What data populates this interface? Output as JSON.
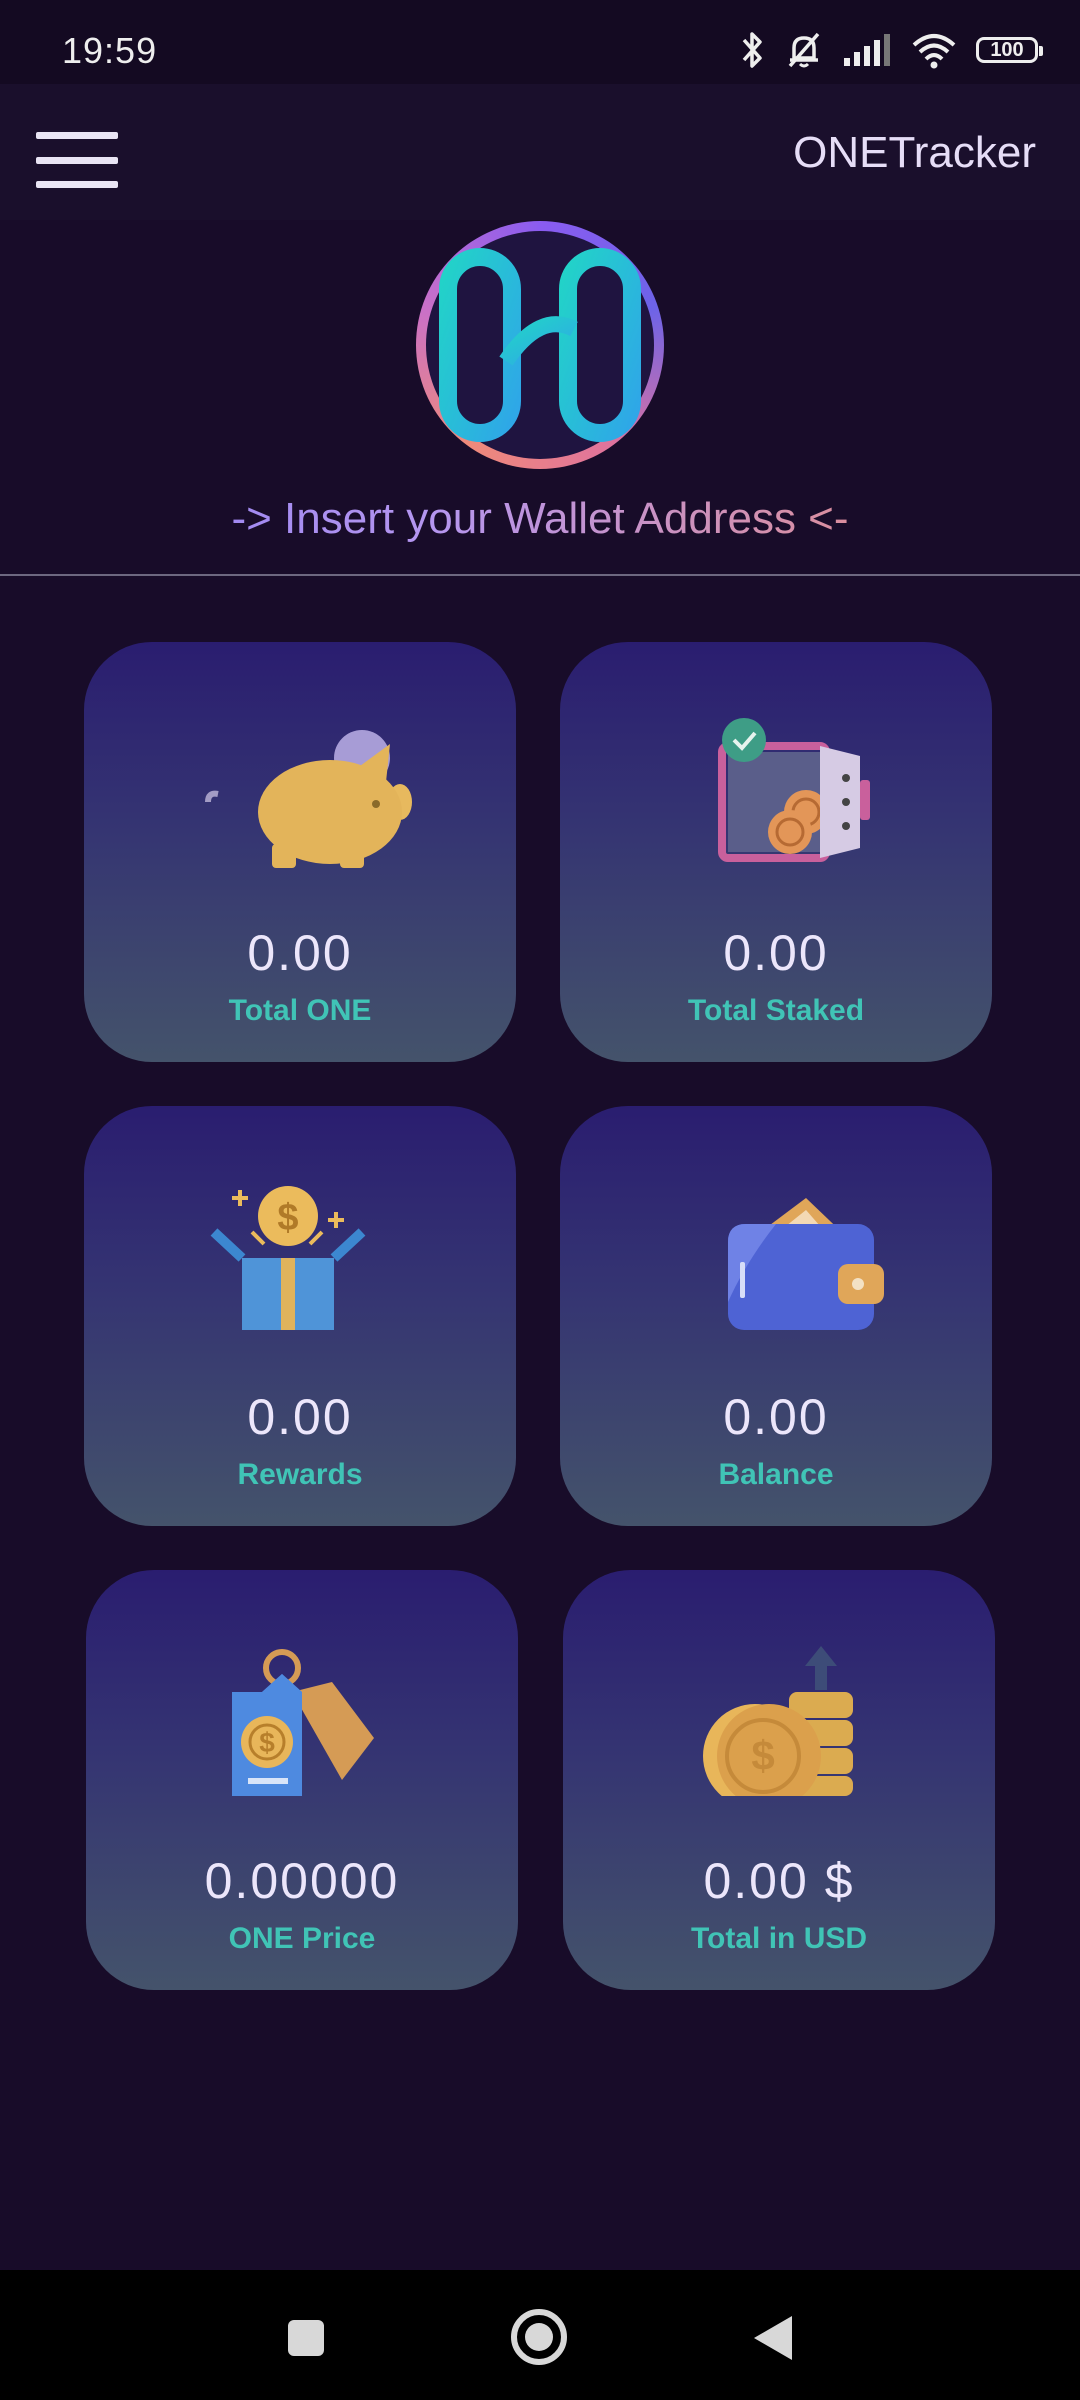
{
  "status_bar": {
    "time": "19:59",
    "battery": "100",
    "icons": [
      "bluetooth-icon",
      "bell-off-icon",
      "signal-icon",
      "wifi-icon",
      "battery-icon"
    ]
  },
  "app_bar": {
    "title": "ONETracker",
    "menu_icon": "hamburger-menu-icon"
  },
  "header": {
    "logo": "harmony-one-logo",
    "wallet_prompt": "-> Insert your Wallet Address <-"
  },
  "cards": [
    {
      "value": "0.00",
      "label": "Total ONE",
      "icon": "piggy-bank-icon"
    },
    {
      "value": "0.00",
      "label": "Total Staked",
      "icon": "safe-icon"
    },
    {
      "value": "0.00",
      "label": "Rewards",
      "icon": "gift-box-icon"
    },
    {
      "value": "0.00",
      "label": "Balance",
      "icon": "wallet-icon"
    },
    {
      "value": "0.00000",
      "label": "ONE Price",
      "icon": "price-tag-icon"
    },
    {
      "value": "0.00 $",
      "label": "Total in USD",
      "icon": "coins-icon"
    }
  ],
  "nav_bar": {
    "buttons": [
      "recents-button",
      "home-button",
      "back-button"
    ]
  },
  "colors": {
    "background": "#180c29",
    "accent_label": "#40c4b6",
    "card_top": "#2a1d70",
    "card_bottom": "#44536b"
  }
}
